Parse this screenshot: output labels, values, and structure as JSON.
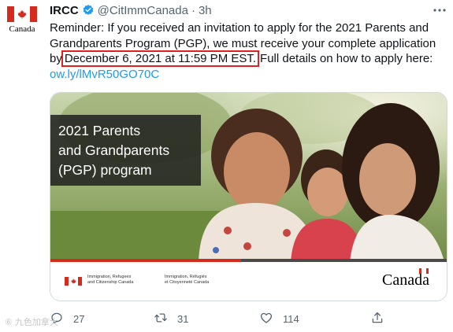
{
  "colors": {
    "text_primary": "#0f1419",
    "text_secondary": "#536471",
    "link": "#1d9bf0",
    "verified": "#1d9bf0",
    "highlight_border": "#e02020",
    "canada_red": "#d52b1e"
  },
  "author": {
    "avatar_icon": "canada-flag-icon",
    "avatar_wordmark": "Canada",
    "display_name": "IRCC",
    "verified_icon": "verified-badge-icon",
    "handle": "@CitImmCanada",
    "separator": "·",
    "time": "3h"
  },
  "tweet": {
    "line1": "Reminder: If you received an invitation to apply for the 2021 Parents and",
    "line2": "Grandparents Program (PGP), we must receive your complete application",
    "line3_before": "by",
    "line3_highlight": "December 6, 2021 at 11:59 PM EST.",
    "line3_after": "Full details on how to apply here:",
    "link": "ow.ly/lMvR50GO70C"
  },
  "card": {
    "title_lines": [
      "2021 Parents",
      "and Grandparents",
      "(PGP) program"
    ],
    "progress_fraction": 0.48,
    "fip_en_line1": "Immigration, Refugees",
    "fip_en_line2": "and Citizenship Canada",
    "fip_fr_line1": "Immigration, Réfugiés",
    "fip_fr_line2": "et Citoyenneté Canada",
    "wordmark": "Canada"
  },
  "actions": {
    "reply_icon": "reply-icon",
    "reply_count": "27",
    "retweet_icon": "retweet-icon",
    "retweet_count": "31",
    "like_icon": "heart-icon",
    "like_count": "114",
    "share_icon": "share-icon"
  },
  "watermark": "⑥ 九色加拿大"
}
